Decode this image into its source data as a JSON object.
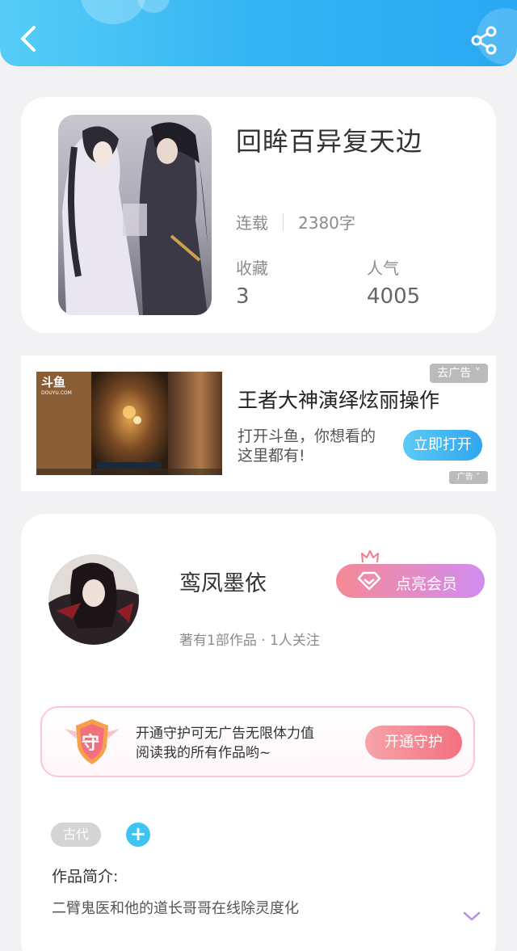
{
  "header": {
    "back_icon": "back-arrow-icon",
    "share_icon": "share-icon",
    "gradient": [
      "#56cdf7",
      "#2aa9f2"
    ]
  },
  "book": {
    "title": "回眸百异复天边",
    "status": "连载",
    "word_count": "2380字",
    "favorites_label": "收藏",
    "favorites_value": "3",
    "popularity_label": "人气",
    "popularity_value": "4005"
  },
  "ad": {
    "title": "王者大神演绎炫丽操作",
    "description": "打开斗鱼，你想看的这里都有!",
    "open_label": "立即打开",
    "close_label": "去广告 ˅",
    "tag_label": "广告 ˅",
    "thumb_logo": "斗鱼",
    "thumb_logo_sub": "DOUYU.COM"
  },
  "author": {
    "name": "鸾凤墨依",
    "meta": "著有1部作品 · 1人关注",
    "vip_label": "点亮会员",
    "guard_badge": "守",
    "guard_text": "开通守护可无广告无限体力值\n阅读我的所有作品哟~",
    "guard_button": "开通守护",
    "tag": "古代",
    "add_tag": "+",
    "intro_label": "作品简介:",
    "intro_text": "二臂鬼医和他的道长哥哥在线除灵度化"
  },
  "colors": {
    "accent_blue": "#3ec5ef",
    "vip_pink": "#f58a96",
    "vip_purple": "#d18df0",
    "guard_red": "#f3707f"
  }
}
